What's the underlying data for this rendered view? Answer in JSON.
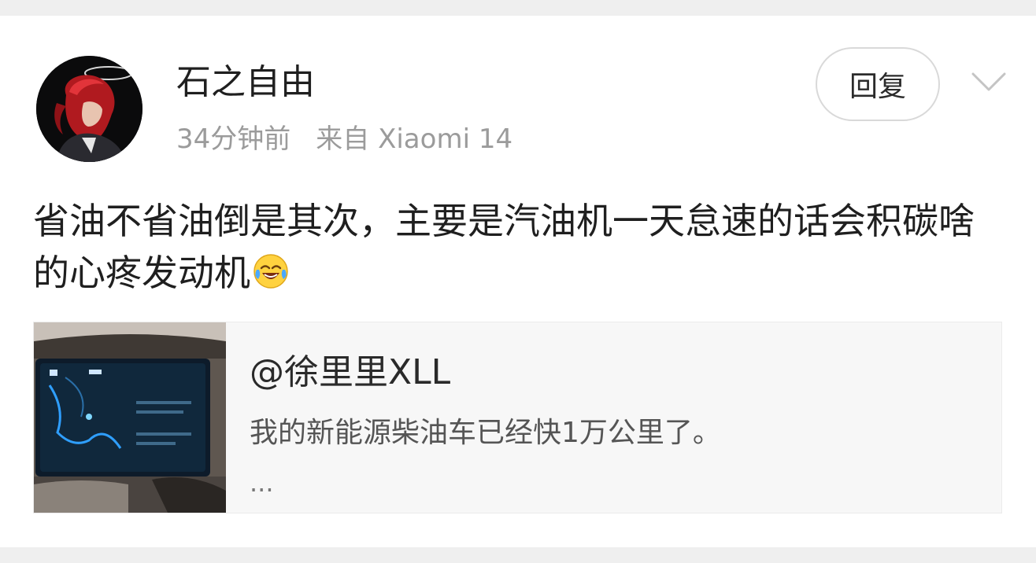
{
  "post": {
    "author": "石之自由",
    "time": "34分钟前",
    "source": "来自 Xiaomi 14",
    "reply_label": "回复",
    "content": "省油不省油倒是其次，主要是汽油机一天怠速的话会积碳啥的心疼发动机",
    "emoji": "laugh-cry-emoji"
  },
  "quote": {
    "author": "@徐里里XLL",
    "text": "我的新能源柴油车已经快1万公里了。",
    "ellipsis": "..."
  }
}
